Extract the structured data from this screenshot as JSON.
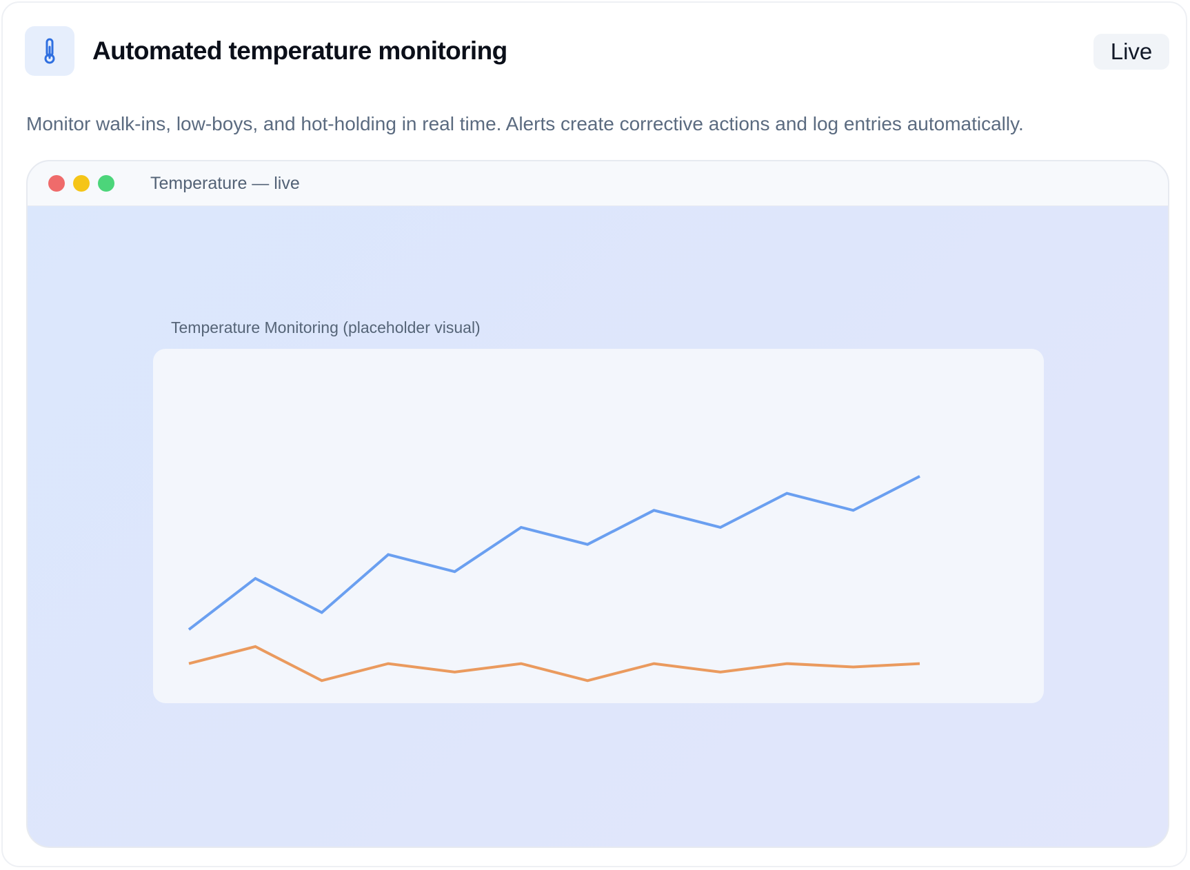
{
  "header": {
    "icon": "thermometer-icon",
    "title": "Automated temperature monitoring",
    "badge": "Live"
  },
  "description": "Monitor walk-ins, low-boys, and hot-holding in real time. Alerts create corrective actions and log entries automatically.",
  "window": {
    "title": "Temperature — live",
    "controls": [
      "close",
      "minimize",
      "zoom"
    ],
    "control_colors": [
      "#ef6b6b",
      "#f5c518",
      "#4cd57a"
    ]
  },
  "chart": {
    "caption": "Temperature Monitoring (placeholder visual)"
  },
  "chart_data": {
    "type": "line",
    "x": [
      1,
      2,
      3,
      4,
      5,
      6,
      7,
      8,
      9,
      10,
      11,
      12
    ],
    "ylim": [
      0,
      100
    ],
    "grid": false,
    "series": [
      {
        "color": "#6a9ff0",
        "values": [
          20,
          35,
          25,
          42,
          37,
          50,
          45,
          55,
          50,
          60,
          55,
          65
        ]
      },
      {
        "color": "#ea9a5e",
        "values": [
          10,
          15,
          5,
          10,
          7.5,
          10,
          5,
          10,
          7.5,
          10,
          9,
          10
        ]
      }
    ]
  }
}
